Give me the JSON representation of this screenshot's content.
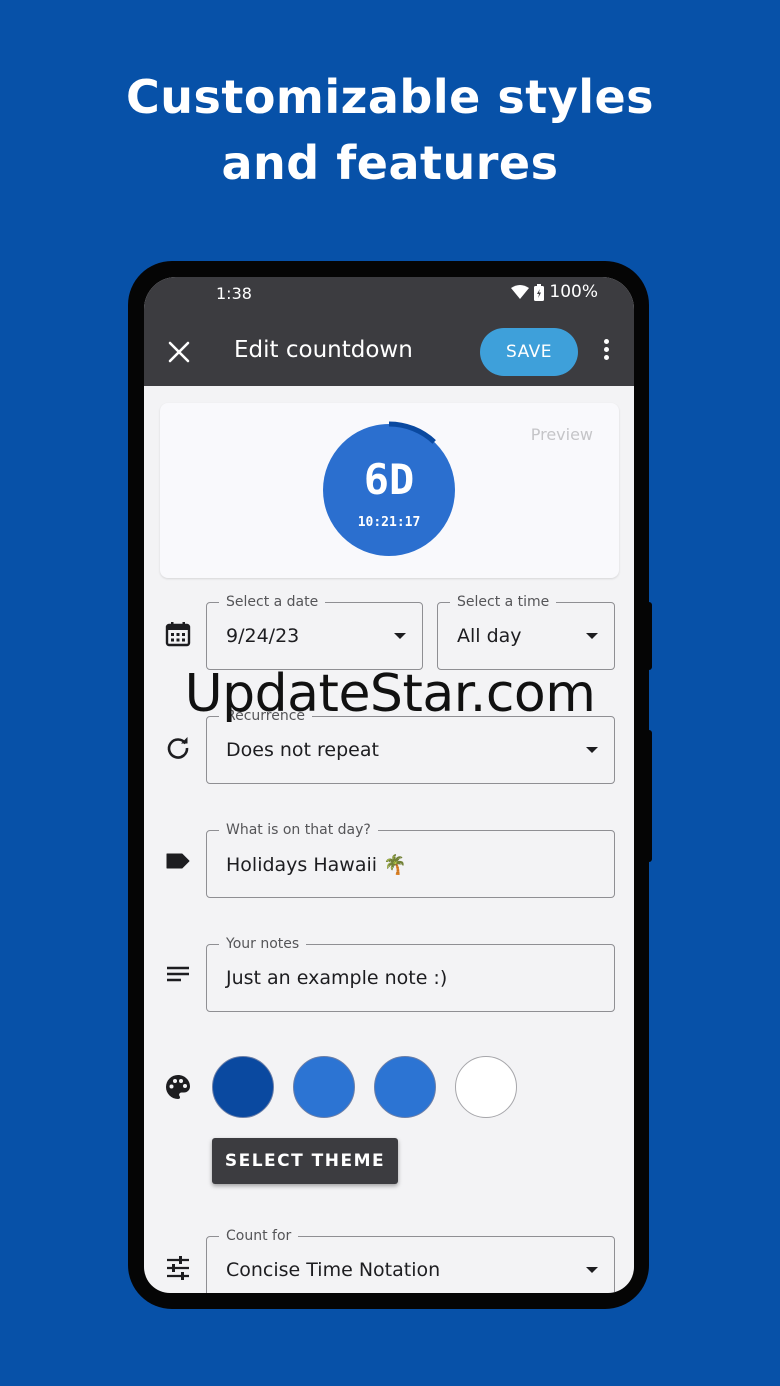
{
  "promo": {
    "headline_line1": "Customizable styles",
    "headline_line2": "and features"
  },
  "status_bar": {
    "time": "1:38",
    "battery": "100%"
  },
  "app_bar": {
    "title": "Edit countdown",
    "save_label": "SAVE"
  },
  "preview": {
    "label": "Preview",
    "days": "6D",
    "time": "10:21:17",
    "progress": 0.12,
    "ring_color": "#2b6fcf"
  },
  "form": {
    "date": {
      "label": "Select a date",
      "value": "9/24/23"
    },
    "time": {
      "label": "Select a time",
      "value": "All day"
    },
    "recurrence": {
      "label": "Recurrence",
      "value": "Does not repeat"
    },
    "event": {
      "label": "What is on that day?",
      "value": "Holidays Hawaii 🌴"
    },
    "notes": {
      "label": "Your notes",
      "value": "Just an example note :)"
    },
    "count_for": {
      "label": "Count for",
      "value": "Concise Time Notation"
    }
  },
  "theme": {
    "swatches": [
      "#0a49a0",
      "#2c74d3",
      "#2c74d3",
      "#ffffff"
    ],
    "select_label": "SELECT THEME"
  },
  "watermark": "UpdateStar.com"
}
